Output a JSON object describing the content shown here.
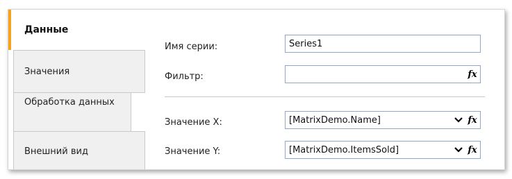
{
  "tabs": [
    {
      "label": "Данные",
      "active": true
    },
    {
      "label": "Значения",
      "active": false
    },
    {
      "label": "Обработка данных",
      "active": false
    },
    {
      "label": "Внешний вид",
      "active": false
    }
  ],
  "form": {
    "series_name_label": "Имя серии:",
    "series_name_value": "Series1",
    "filter_label": "Фильтр:",
    "filter_value": "",
    "x_value_label": "Значение X:",
    "x_value": "[MatrixDemo.Name]",
    "y_value_label": "Значение Y:",
    "y_value": "[MatrixDemo.ItemsSold]",
    "fx_symbol": "fx"
  },
  "colors": {
    "active_tab_accent": "#f5a31a",
    "field_border": "#8fa7c9"
  },
  "icons": {
    "expression": "fx-icon",
    "dropdown": "chevron-down-icon"
  }
}
